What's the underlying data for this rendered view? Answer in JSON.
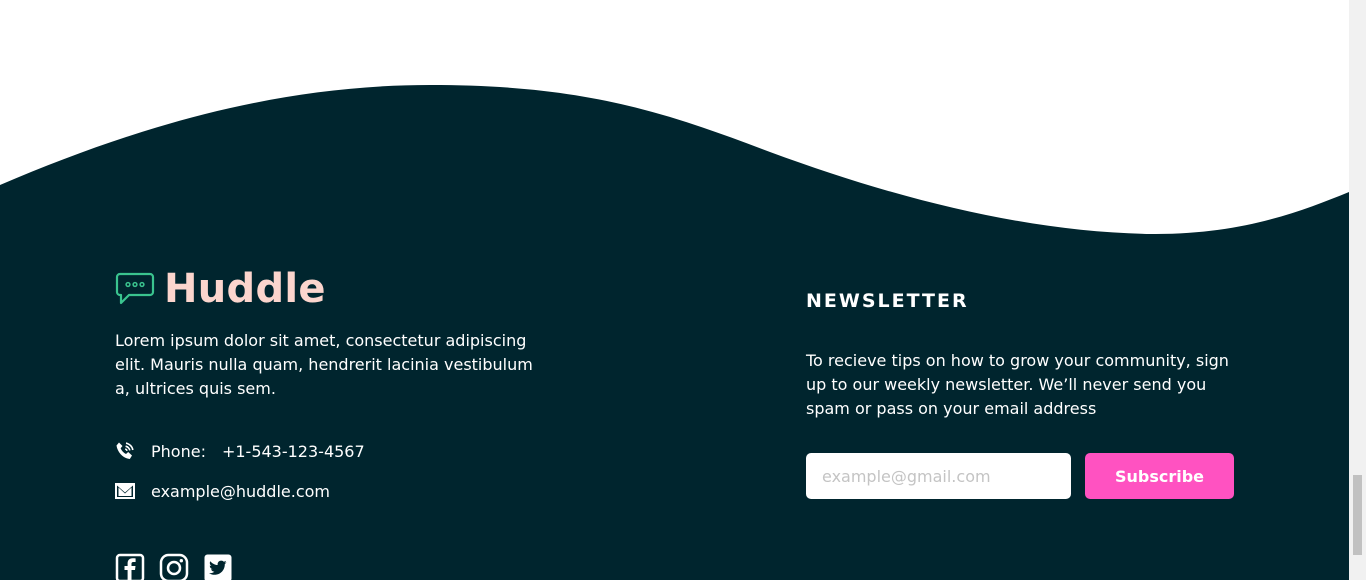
{
  "colors": {
    "footer_bg": "#00252e",
    "logo_text": "#fbd5cd",
    "logo_icon": "#3ac48f",
    "accent_button": "#ff52c1"
  },
  "brand": {
    "name": "Huddle",
    "logo_icon": "chat-bubble-icon"
  },
  "about": {
    "text": "Lorem ipsum dolor sit amet, consectetur adipiscing elit. Mauris nulla quam, hendrerit lacinia vestibulum a, ultrices quis sem."
  },
  "contact": {
    "phone_label": "Phone:",
    "phone_value": "+1-543-123-4567",
    "phone_icon": "phone-icon",
    "email_value": "example@huddle.com",
    "email_icon": "mail-icon"
  },
  "socials": [
    {
      "name": "facebook-icon"
    },
    {
      "name": "instagram-icon"
    },
    {
      "name": "twitter-icon"
    }
  ],
  "newsletter": {
    "title": "NEWSLETTER",
    "text": "To recieve tips on how to grow your community, sign up to our weekly newsletter. We’ll never send you spam or pass on your email address",
    "input_placeholder": "example@gmail.com",
    "button_label": "Subscribe"
  }
}
